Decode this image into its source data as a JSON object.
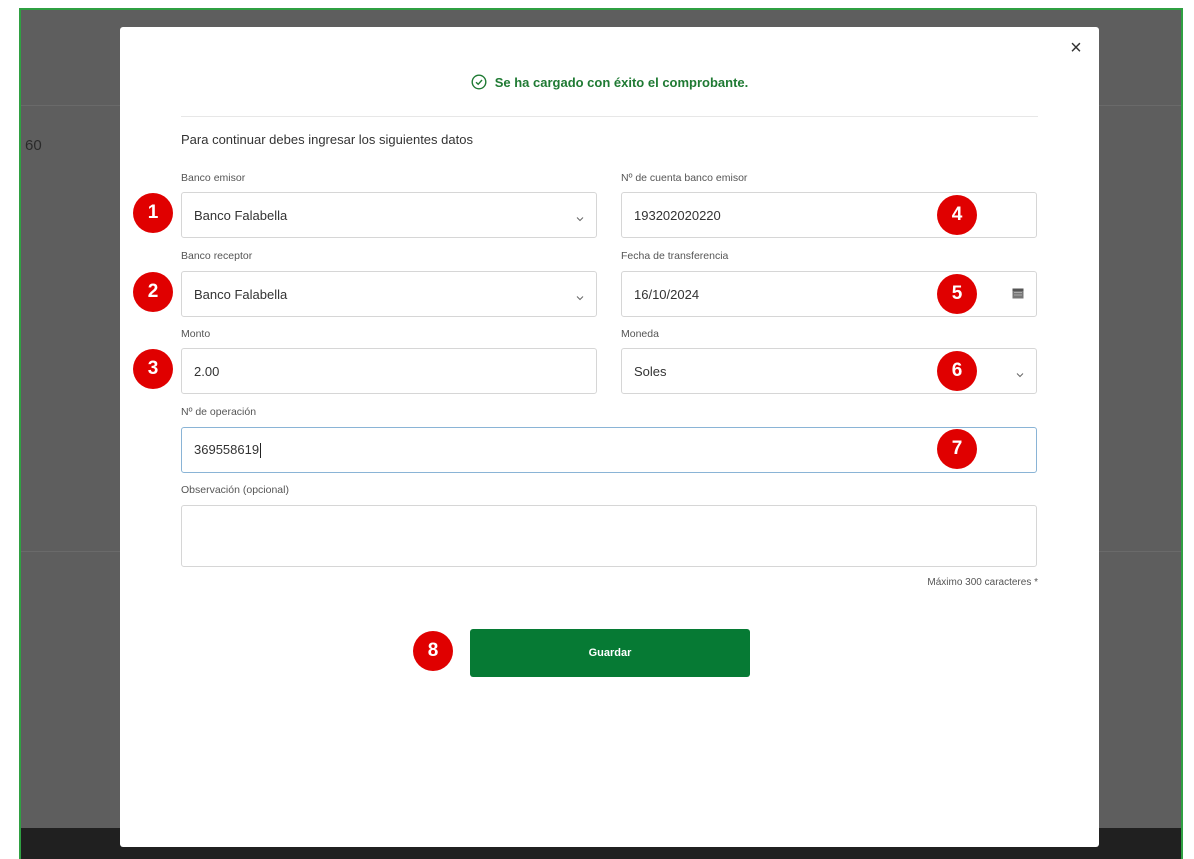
{
  "background": {
    "partial_number": "60"
  },
  "modal": {
    "close_symbol": "×",
    "success_message": "Se ha cargado con éxito el comprobante.",
    "instruction": "Para continuar debes ingresar los siguientes datos"
  },
  "form": {
    "banco_emisor": {
      "label": "Banco emisor",
      "value": "Banco Falabella"
    },
    "cuenta_emisor": {
      "label": "Nº de cuenta banco emisor",
      "value": "193202020220"
    },
    "banco_receptor": {
      "label": "Banco receptor",
      "value": "Banco Falabella"
    },
    "fecha": {
      "label": "Fecha de transferencia",
      "value": "16/10/2024"
    },
    "monto": {
      "label": "Monto",
      "value": "2.00"
    },
    "moneda": {
      "label": "Moneda",
      "value": "Soles"
    },
    "operacion": {
      "label": "Nº de operación",
      "value": "369558619"
    },
    "observacion": {
      "label": "Observación (opcional)",
      "value": ""
    },
    "max_chars": "Máximo 300 caracteres *"
  },
  "save_label": "Guardar",
  "badges": [
    "1",
    "2",
    "3",
    "4",
    "5",
    "6",
    "7",
    "8"
  ],
  "colors": {
    "accent_green": "#067a34",
    "success_green": "#1f7a33",
    "badge_red": "#e00000",
    "frame_green": "#2fa042"
  }
}
